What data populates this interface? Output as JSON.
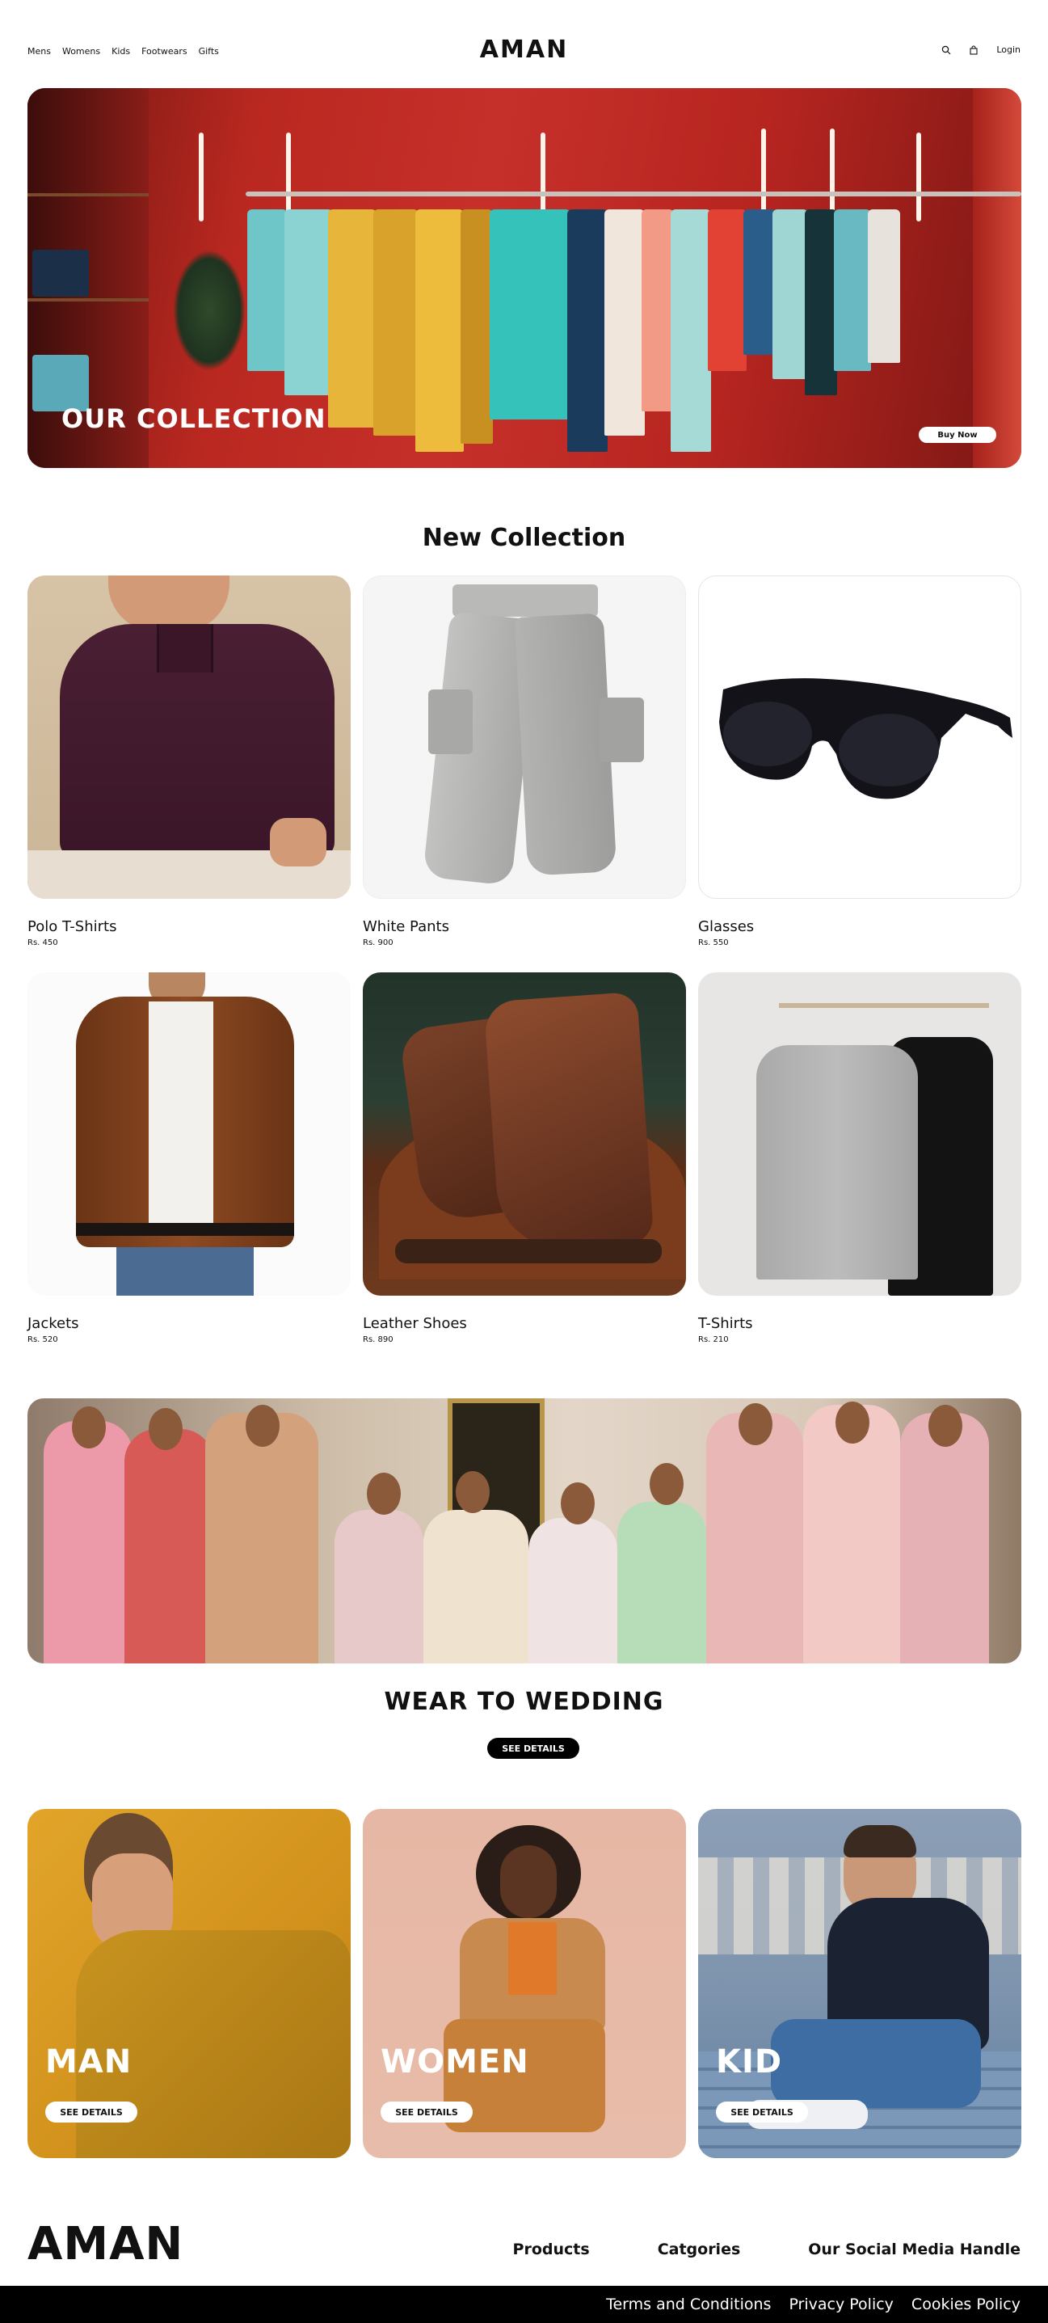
{
  "nav": {
    "left_links": [
      "Mens",
      "Womens",
      "Kids",
      "Footwears",
      "Gifts"
    ],
    "logo": "AMAN",
    "search_icon": "search-icon",
    "bag_icon": "shopping-bag-icon",
    "login": "Login"
  },
  "hero": {
    "title": "OUR COLLECTION",
    "button": "Buy Now"
  },
  "new_collection": {
    "title": "New Collection",
    "products": [
      {
        "name": "Polo T-Shirts",
        "price": "Rs. 450"
      },
      {
        "name": "White Pants",
        "price": "Rs. 900"
      },
      {
        "name": "Glasses",
        "price": "Rs. 550"
      },
      {
        "name": "Jackets",
        "price": "Rs. 520"
      },
      {
        "name": "Leather Shoes",
        "price": "Rs. 890"
      },
      {
        "name": "T-Shirts",
        "price": "Rs. 210"
      }
    ]
  },
  "wedding": {
    "title": "WEAR TO WEDDING",
    "button": "SEE DETAILS"
  },
  "categories": [
    {
      "title": "MAN",
      "button": "SEE DETAILS"
    },
    {
      "title": "WOMEN",
      "button": "SEE DETAILS"
    },
    {
      "title": "KID",
      "button": "SEE DETAILS"
    }
  ],
  "footer": {
    "logo": "AMAN",
    "links": [
      "Products",
      "Catgories",
      "Our Social Media Handle"
    ],
    "bottom_links": [
      "Terms and Conditions",
      "Privacy Policy",
      "Cookies Policy"
    ]
  },
  "colors": {
    "hero_red": "#c6302a",
    "mustard": "#d9a12a",
    "blush": "#e7b7a4",
    "slate_blue": "#6f8aa6",
    "black": "#000000"
  }
}
